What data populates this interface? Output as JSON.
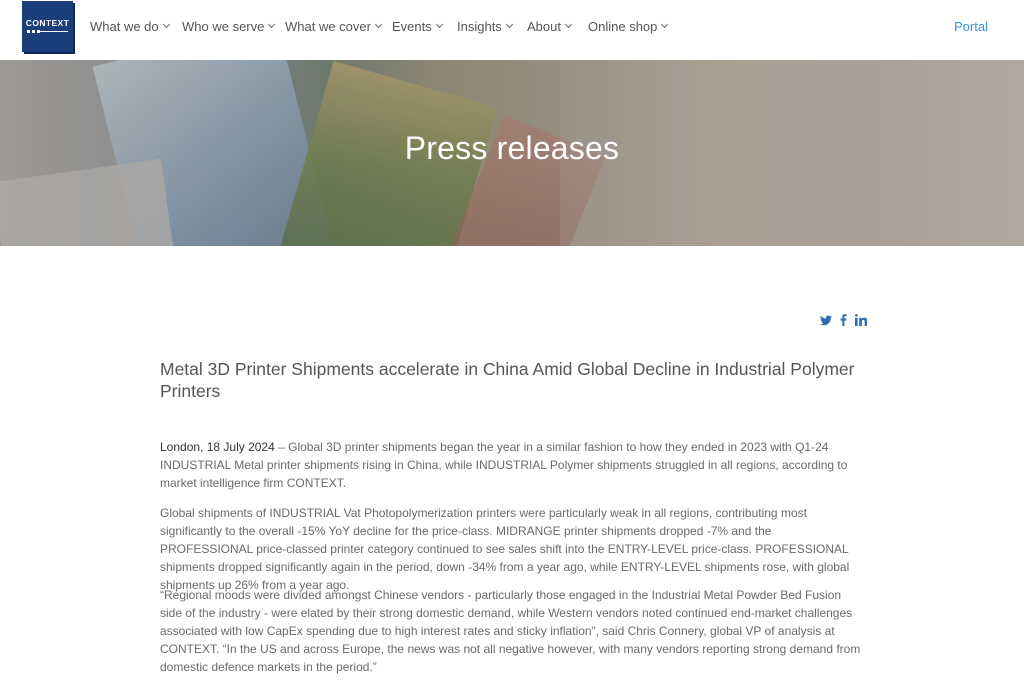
{
  "header": {
    "logo_text": "CONTEXT",
    "nav": [
      {
        "label": "What we do"
      },
      {
        "label": "Who we serve"
      },
      {
        "label": "What we cover"
      },
      {
        "label": "Events"
      },
      {
        "label": "Insights"
      },
      {
        "label": "About"
      },
      {
        "label": "Online shop"
      }
    ],
    "portal_label": "Portal"
  },
  "hero": {
    "title": "Press releases"
  },
  "social": {
    "icons": [
      "twitter-icon",
      "facebook-icon",
      "linkedin-icon"
    ],
    "color": "#2e6db4"
  },
  "article": {
    "headline": "Metal 3D Printer Shipments accelerate in China Amid Global Decline in Industrial Polymer Printers",
    "dateline": "London, 18 July 2024",
    "p1": " – Global 3D printer shipments began the year in a similar fashion to how they ended in 2023 with Q1-24 INDUSTRIAL Metal printer shipments rising in China, while INDUSTRIAL Polymer shipments struggled in all regions, according to market intelligence firm CONTEXT.",
    "p2": "Global shipments of INDUSTRIAL Vat Photopolymerization printers were particularly weak in all regions, contributing most significantly to the overall -15% YoY decline for the price-class. MIDRANGE printer shipments dropped -7% and the PROFESSIONAL price-classed printer category continued to see sales shift into the ENTRY-LEVEL price-class. PROFESSIONAL shipments dropped significantly again in the period, down -34% from a year ago, while ENTRY-LEVEL shipments rose, with global shipments up 26% from a year ago.",
    "p3": "“Regional moods were divided amongst Chinese vendors - particularly those engaged in the Industrial Metal Powder Bed Fusion side of the industry - were elated by their strong domestic demand, while Western vendors noted continued end-market challenges associated with low CapEx spending due to high interest rates and sticky inflation”, said Chris Connery, global VP of analysis at CONTEXT. “In the US and across Europe, the news was not all negative however, with many vendors reporting strong demand from domestic defence markets in the period.”"
  },
  "colors": {
    "brand": "#1b3f7a",
    "link": "#3a8fd6",
    "text": "#6a6a6a"
  }
}
